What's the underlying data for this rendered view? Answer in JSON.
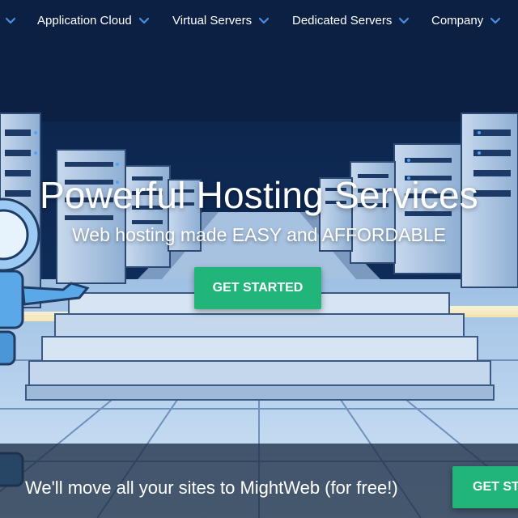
{
  "nav": {
    "items": [
      {
        "label": ""
      },
      {
        "label": "Application Cloud"
      },
      {
        "label": "Virtual Servers"
      },
      {
        "label": "Dedicated Servers"
      },
      {
        "label": "Company"
      }
    ]
  },
  "hero": {
    "title": "Powerful Hosting Services",
    "subtitle": "Web hosting made EASY and AFFORDABLE",
    "cta_label": "GET STARTED"
  },
  "banner": {
    "text": "We'll move all your sites to MightWeb (for free!)",
    "cta_label": "GET STARTED"
  },
  "colors": {
    "nav_bg": "#0d2447",
    "accent_green": "#22b57a",
    "chevron_blue": "#4a90e2",
    "banner_bg": "#1e3046"
  }
}
